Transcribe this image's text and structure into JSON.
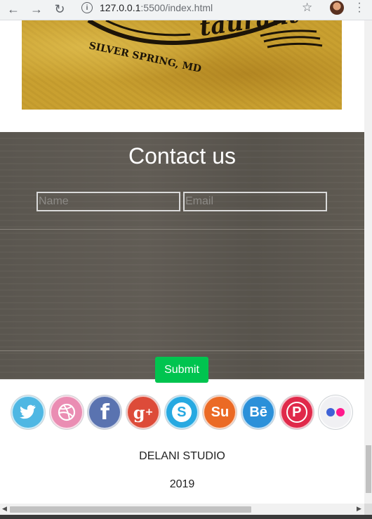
{
  "browser": {
    "url_host": "127.0.0.1",
    "url_path": ":5500/index.html",
    "back_icon": "arrow-left-icon",
    "forward_icon": "arrow-right-icon",
    "reload_icon": "reload-icon",
    "info_icon": "info-icon",
    "star_icon": "star-icon",
    "menu_icon": "kebab-menu-icon"
  },
  "hero": {
    "logo_text": "SILVER SPRING, MD",
    "logo_script": "taurant"
  },
  "contact": {
    "title": "Contact us",
    "name_placeholder": "Name",
    "email_placeholder": "Email",
    "submit_label": "Submit"
  },
  "socials": [
    {
      "name": "twitter",
      "color": "#4fb7e3",
      "glyph": "🐦"
    },
    {
      "name": "dribbble",
      "color": "#ea8db3",
      "glyph": "◍"
    },
    {
      "name": "facebook",
      "color": "#5a73b0",
      "glyph": "f"
    },
    {
      "name": "google-plus",
      "color": "#dd4b39",
      "glyph": "g+"
    },
    {
      "name": "skype",
      "color": "#27a9e1",
      "glyph": "S"
    },
    {
      "name": "stumbleupon",
      "color": "#eb6a25",
      "glyph": "Su"
    },
    {
      "name": "behance",
      "color": "#2b90d9",
      "glyph": "Bē"
    },
    {
      "name": "pinterest",
      "color": "#e0294a",
      "glyph": "P"
    },
    {
      "name": "flickr",
      "color": "#f0f0f3",
      "glyph": "●●"
    }
  ],
  "footer": {
    "studio": "DELANI STUDIO",
    "year": "2019"
  }
}
